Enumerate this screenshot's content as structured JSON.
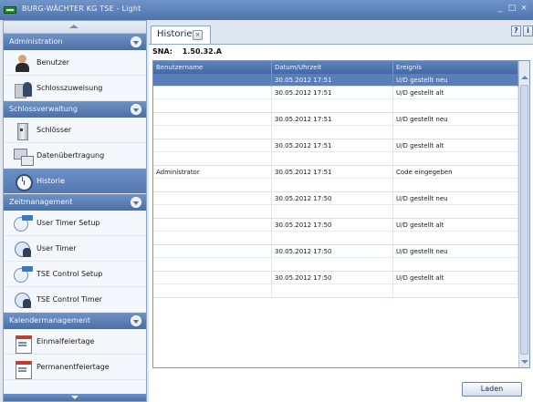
{
  "window": {
    "title": "BURG-WÄCHTER KG TSE - Light",
    "controls": [
      "_",
      "□",
      "×"
    ]
  },
  "sidebar": {
    "groups": [
      {
        "title": "Administration",
        "items": [
          {
            "label": "Benutzer",
            "icon": "user-icon"
          },
          {
            "label": "Schlosszuweisung",
            "icon": "lock-assignment-icon"
          }
        ]
      },
      {
        "title": "Schlossverwaltung",
        "items": [
          {
            "label": "Schlösser",
            "icon": "lock-icon"
          },
          {
            "label": "Datenübertragung",
            "icon": "data-transfer-icon"
          },
          {
            "label": "Historie",
            "icon": "history-icon",
            "active": true
          }
        ]
      },
      {
        "title": "Zeitmanagement",
        "items": [
          {
            "label": "User Timer Setup",
            "icon": "timer-setup-icon"
          },
          {
            "label": "User Timer",
            "icon": "user-timer-icon"
          },
          {
            "label": "TSE Control Setup",
            "icon": "control-setup-icon"
          },
          {
            "label": "TSE Control Timer",
            "icon": "control-timer-icon"
          }
        ]
      },
      {
        "title": "Kalendermanagement",
        "items": [
          {
            "label": "Einmalfeiertage",
            "icon": "calendar-icon"
          },
          {
            "label": "Permanentfeiertage",
            "icon": "calendar-permanent-icon"
          }
        ]
      }
    ]
  },
  "tab": {
    "label": "Historie",
    "close": "×"
  },
  "buttons": {
    "help": "?",
    "info": "i",
    "load": "Laden"
  },
  "sna": {
    "label": "SNA:",
    "value": "1.50.32.A"
  },
  "table": {
    "columns": [
      "Benutzername",
      "Datum/Uhrzeit",
      "Ereignis"
    ],
    "rows": [
      {
        "user": "",
        "datetime": "30.05.2012 17:51",
        "event": "U/D gestellt neu",
        "selected": true
      },
      {
        "user": "",
        "datetime": "30.05.2012 17:51",
        "event": "U/D gestellt alt"
      },
      {
        "user": "",
        "datetime": "30.05.2012 17:51",
        "event": "U/D gestellt neu"
      },
      {
        "user": "",
        "datetime": "30.05.2012 17:51",
        "event": "U/D gestellt alt"
      },
      {
        "user": "Administrator",
        "datetime": "30.05.2012 17:51",
        "event": "Code eingegeben"
      },
      {
        "user": "",
        "datetime": "30.05.2012 17:50",
        "event": "U/D gestellt neu"
      },
      {
        "user": "",
        "datetime": "30.05.2012 17:50",
        "event": "U/D gestellt alt"
      },
      {
        "user": "",
        "datetime": "30.05.2012 17:50",
        "event": "U/D gestellt neu"
      },
      {
        "user": "",
        "datetime": "30.05.2012 17:50",
        "event": "U/D gestellt alt"
      }
    ]
  },
  "colors": {
    "accent": "#5479b2",
    "header": "#4b6fa6",
    "selection": "#5a7fb8"
  }
}
